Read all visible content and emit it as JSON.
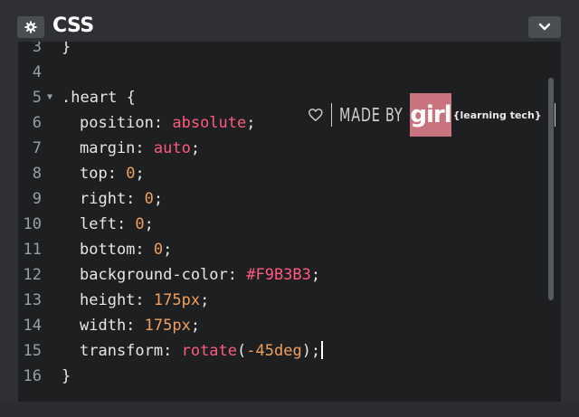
{
  "header": {
    "title": "CSS",
    "settings_icon": "gear-icon",
    "collapse_icon": "chevron-down-icon"
  },
  "watermark": {
    "made_by": "MADE BY",
    "brand": "girl",
    "tagline": "{learning tech}",
    "icon": "heart-outline-icon"
  },
  "colors": {
    "keyword": "#ff5a7e",
    "number": "#f0a05a",
    "text": "#e6e6e6",
    "brand_pink": "#c9737e"
  },
  "editor": {
    "lines": [
      {
        "n": "3",
        "t": "}"
      },
      {
        "n": "4",
        "t": ""
      },
      {
        "n": "5",
        "t": ".heart {",
        "fold": "▼"
      },
      {
        "n": "6",
        "p": "position: ",
        "v": "absolute",
        "vt": "kw",
        "e": ";"
      },
      {
        "n": "7",
        "p": "margin: ",
        "v": "auto",
        "vt": "kw",
        "e": ";"
      },
      {
        "n": "8",
        "p": "top: ",
        "v": "0",
        "vt": "num",
        "e": ";"
      },
      {
        "n": "9",
        "p": "right: ",
        "v": "0",
        "vt": "num",
        "e": ";"
      },
      {
        "n": "10",
        "p": "left: ",
        "v": "0",
        "vt": "num",
        "e": ";"
      },
      {
        "n": "11",
        "p": "bottom: ",
        "v": "0",
        "vt": "num",
        "e": ";"
      },
      {
        "n": "12",
        "p": "background-color: ",
        "v": "#F9B3B3",
        "vt": "hex",
        "e": ";"
      },
      {
        "n": "13",
        "p": "height: ",
        "v": "175px",
        "vt": "num",
        "e": ";"
      },
      {
        "n": "14",
        "p": "width: ",
        "v": "175px",
        "vt": "num",
        "e": ";"
      },
      {
        "n": "15",
        "p": "transform: ",
        "v": "rotate",
        "vt": "kw",
        "v2": "(",
        "v3": "-45deg",
        "e": ");"
      },
      {
        "n": "16",
        "t": "}"
      }
    ]
  }
}
